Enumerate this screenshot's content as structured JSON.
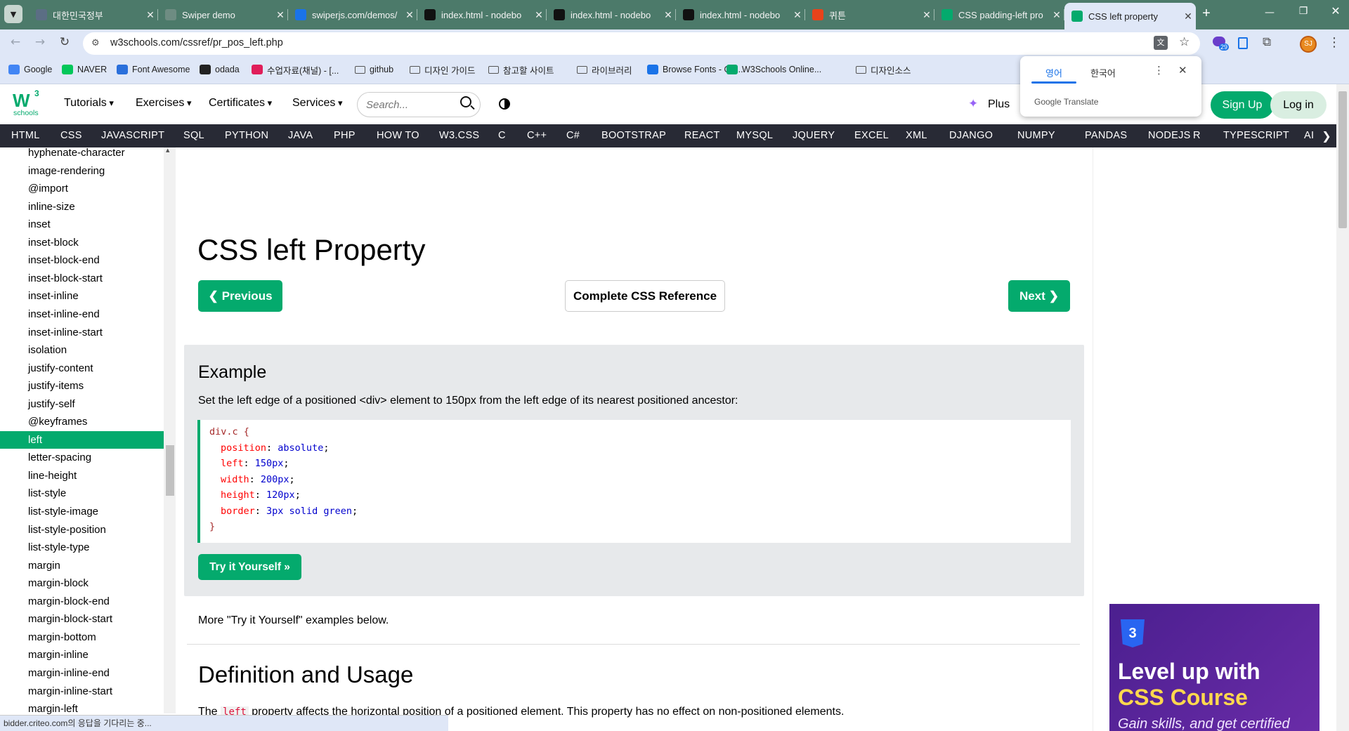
{
  "browser": {
    "tabs": [
      {
        "title": "대한민국정부",
        "fav_color": "#5b6e84"
      },
      {
        "title": "Swiper demo",
        "fav_color": "#6e8c82"
      },
      {
        "title": "swiperjs.com/demos/",
        "fav_color": "#1a73e8"
      },
      {
        "title": "index.html - nodebo",
        "fav_color": "#111111"
      },
      {
        "title": "index.html - nodebo",
        "fav_color": "#111111"
      },
      {
        "title": "index.html - nodebo",
        "fav_color": "#111111"
      },
      {
        "title": "퀴튼",
        "fav_color": "#e8431a"
      },
      {
        "title": "CSS padding-left pro",
        "fav_color": "#04aa6d"
      },
      {
        "title": "CSS left property",
        "fav_color": "#04aa6d"
      }
    ],
    "url": "w3schools.com/cssref/pr_pos_left.php",
    "extension_badge": "29",
    "profile_initials": "SJ",
    "bookmarks": [
      {
        "label": "Google",
        "icon": "google-icon"
      },
      {
        "label": "NAVER",
        "icon": "naver-icon"
      },
      {
        "label": "Font Awesome",
        "icon": "flag-icon"
      },
      {
        "label": "odada",
        "icon": "odada-icon"
      },
      {
        "label": "수업자료(채널) - [...",
        "icon": "slack-icon"
      },
      {
        "label": "github",
        "icon": "folder-icon"
      },
      {
        "label": "디자인 가이드",
        "icon": "folder-icon"
      },
      {
        "label": "참고할 사이트",
        "icon": "folder-icon"
      },
      {
        "label": "라이브러리",
        "icon": "folder-icon"
      },
      {
        "label": "Browse Fonts - Go...",
        "icon": "fonts-icon"
      },
      {
        "label": "W3Schools Online...",
        "icon": "w3-icon"
      },
      {
        "label": "디자인소스",
        "icon": "folder-icon"
      }
    ],
    "translate_popup": {
      "lang_from": "영어",
      "lang_to": "한국어",
      "brand": "Google Translate"
    },
    "status_text": "bidder.criteo.com의 응답을 기다리는 중..."
  },
  "header": {
    "logo_num": "3",
    "logo_text": "schools",
    "menu": [
      "Tutorials",
      "Exercises",
      "Certificates",
      "Services"
    ],
    "search_placeholder": "Search...",
    "plus": "Plus",
    "signup": "Sign Up",
    "login": "Log in"
  },
  "topnav": [
    "HTML",
    "CSS",
    "JAVASCRIPT",
    "SQL",
    "PYTHON",
    "JAVA",
    "PHP",
    "HOW TO",
    "W3.CSS",
    "C",
    "C++",
    "C#",
    "BOOTSTRAP",
    "REACT",
    "MYSQL",
    "JQUERY",
    "EXCEL",
    "XML",
    "DJANGO",
    "NUMPY",
    "PANDAS",
    "NODEJS",
    "R",
    "TYPESCRIPT",
    "AI"
  ],
  "sidebar": {
    "items": [
      "hyphenate-character",
      "image-rendering",
      "@import",
      "inline-size",
      "inset",
      "inset-block",
      "inset-block-end",
      "inset-block-start",
      "inset-inline",
      "inset-inline-end",
      "inset-inline-start",
      "isolation",
      "justify-content",
      "justify-items",
      "justify-self",
      "@keyframes",
      "left",
      "letter-spacing",
      "line-height",
      "list-style",
      "list-style-image",
      "list-style-position",
      "list-style-type",
      "margin",
      "margin-block",
      "margin-block-end",
      "margin-block-start",
      "margin-bottom",
      "margin-inline",
      "margin-inline-end",
      "margin-inline-start",
      "margin-left"
    ],
    "active_item": "left"
  },
  "main": {
    "title": "CSS left Property",
    "prev": "Previous",
    "reference": "Complete CSS Reference",
    "next": "Next",
    "example_heading": "Example",
    "example_desc": "Set the left edge of a positioned <div> element to 150px from the left edge of its nearest positioned ancestor:",
    "code": {
      "selector": "div.c",
      "lines": [
        {
          "prop": "position",
          "value": "absolute"
        },
        {
          "prop": "left",
          "value": "150px"
        },
        {
          "prop": "width",
          "value": "200px"
        },
        {
          "prop": "height",
          "value": "120px"
        },
        {
          "prop": "border",
          "value": "3px solid green"
        }
      ]
    },
    "try_it": "Try it Yourself »",
    "more_examples": "More \"Try it Yourself\" examples below.",
    "definition_heading": "Definition and Usage",
    "definition_pre": "The",
    "definition_code": "left",
    "definition_post": "property affects the horizontal position of a positioned element. This property has no effect on non-positioned elements."
  },
  "ad": {
    "line1": "Level up with",
    "line2": "CSS Course",
    "line3": "Gain skills, and get certified"
  }
}
